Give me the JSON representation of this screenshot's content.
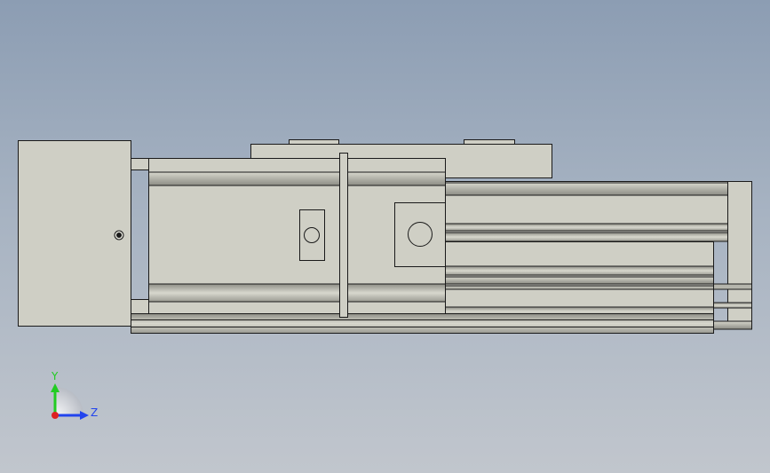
{
  "viewport": {
    "background_top": "#8c9db3",
    "background_bottom": "#c1c6cd"
  },
  "model": {
    "body_fill": "#cfcfc5",
    "body_dark": "#a9a99f",
    "edge_color": "#1a1a1a"
  },
  "triad": {
    "y_label": "Y",
    "z_label": "Z",
    "y_color": "#22cc22",
    "z_color": "#2244ee",
    "x_color": "#dd2222"
  }
}
